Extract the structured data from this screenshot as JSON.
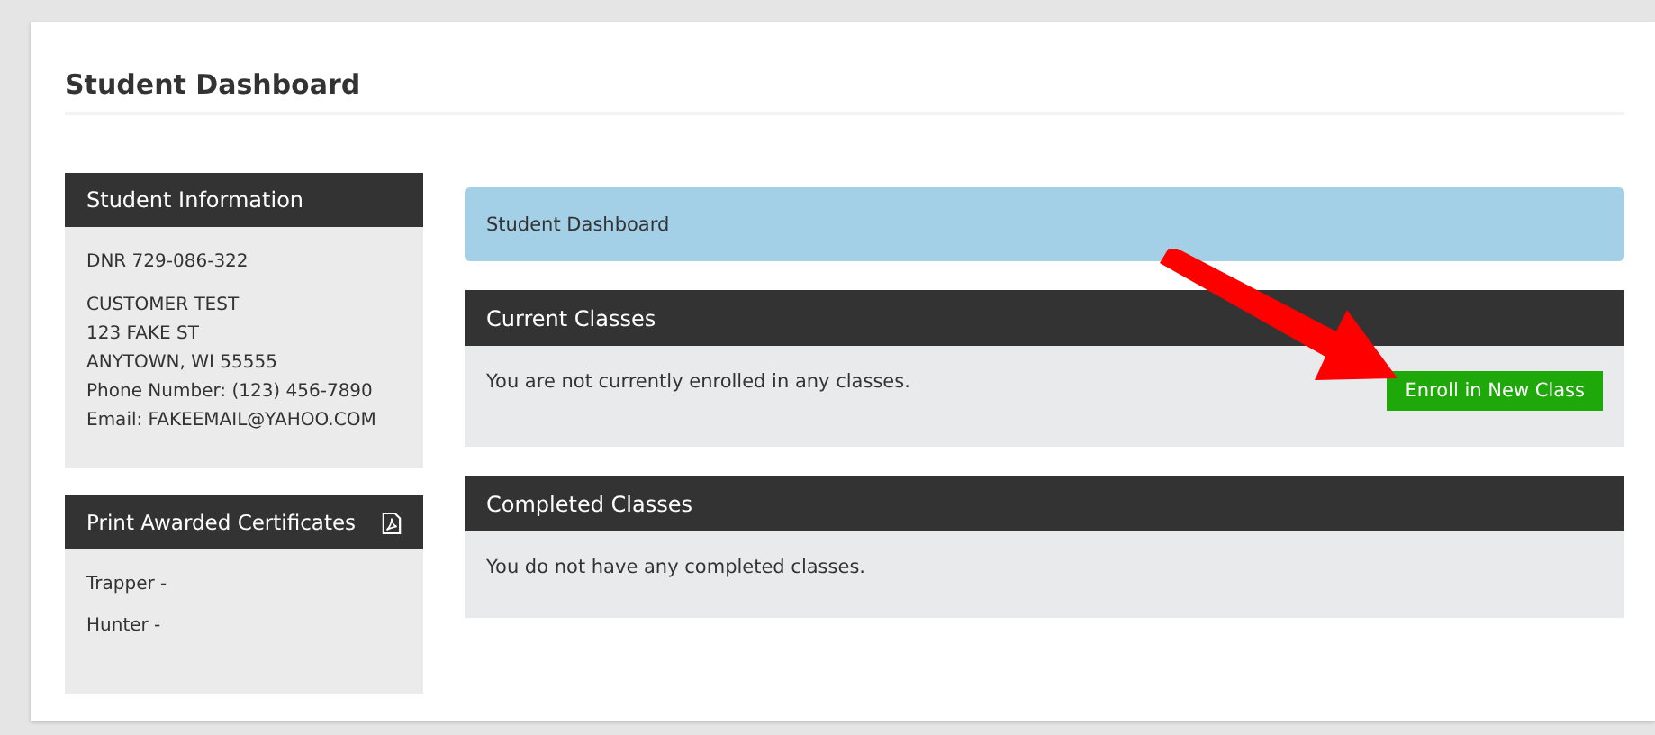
{
  "page_title": "Student Dashboard",
  "student_info": {
    "heading": "Student Information",
    "dnr": "DNR 729-086-322",
    "address_lines": [
      "CUSTOMER TEST",
      "123 FAKE ST",
      "ANYTOWN, WI 55555",
      "Phone Number: (123) 456-7890",
      "Email: FAKEEMAIL@YAHOO.COM"
    ]
  },
  "certificates": {
    "heading": "Print Awarded Certificates",
    "items": [
      "Trapper -",
      "Hunter -"
    ]
  },
  "alert": "Student Dashboard",
  "current_classes": {
    "heading": "Current Classes",
    "message": "You are not currently enrolled in any classes.",
    "button": "Enroll in New Class"
  },
  "completed_classes": {
    "heading": "Completed Classes",
    "message": "You do not have any completed classes."
  }
}
